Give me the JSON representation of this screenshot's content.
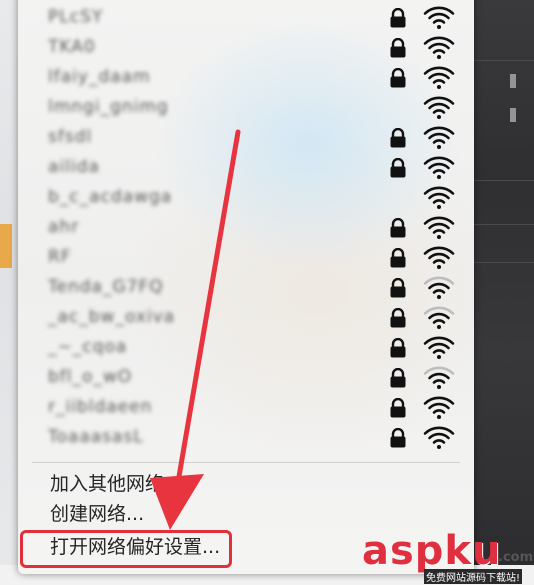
{
  "networks": [
    {
      "name": "PLcSY",
      "locked": true,
      "signal": 3
    },
    {
      "name": "TKA0",
      "locked": true,
      "signal": 3
    },
    {
      "name": "lfaiy_daam",
      "locked": true,
      "signal": 3
    },
    {
      "name": "lmngi_gnimg",
      "locked": false,
      "signal": 3
    },
    {
      "name": "sfsdl",
      "locked": true,
      "signal": 3
    },
    {
      "name": "ailida",
      "locked": true,
      "signal": 3
    },
    {
      "name": "b_c_acdawga",
      "locked": false,
      "signal": 3
    },
    {
      "name": "ahr",
      "locked": true,
      "signal": 3
    },
    {
      "name": "RF",
      "locked": true,
      "signal": 3
    },
    {
      "name": "Tenda_G7FQ",
      "locked": true,
      "signal": 2
    },
    {
      "name": "_ac_bw_oxiva",
      "locked": true,
      "signal": 2
    },
    {
      "name": "_~_cqoa",
      "locked": true,
      "signal": 3
    },
    {
      "name": "bfl_o_wO",
      "locked": true,
      "signal": 2
    },
    {
      "name": "r_iibldaeen",
      "locked": true,
      "signal": 3
    },
    {
      "name": "ToaaasasL",
      "locked": true,
      "signal": 3
    }
  ],
  "menu": {
    "join_other": "加入其他网络...",
    "create_network": "创建网络...",
    "open_preferences": "打开网络偏好设置..."
  },
  "watermark": {
    "logo": "aspku",
    "tld": ".com",
    "subtitle": "免费网站源码下载站!"
  },
  "colors": {
    "annotation_red": "#e0303b"
  }
}
